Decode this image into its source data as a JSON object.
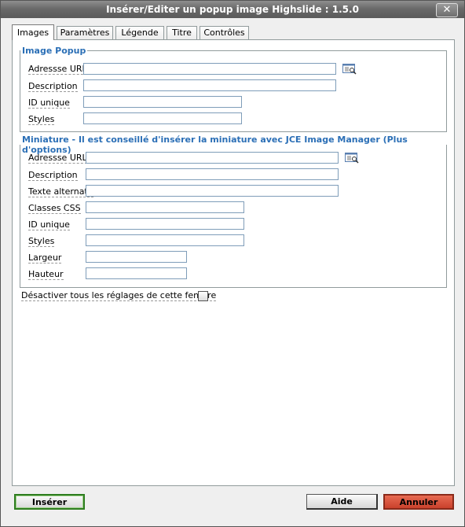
{
  "window": {
    "title": "Insérer/Editer un popup image Highslide : 1.5.0",
    "close_label": "✕"
  },
  "tabs": [
    {
      "label": "Images",
      "active": true
    },
    {
      "label": "Paramètres",
      "active": false
    },
    {
      "label": "Légende",
      "active": false
    },
    {
      "label": "Titre",
      "active": false
    },
    {
      "label": "Contrôles",
      "active": false
    }
  ],
  "popup_section": {
    "legend": "Image Popup",
    "fields": {
      "url": {
        "label": "Adressse URL",
        "value": ""
      },
      "description": {
        "label": "Description",
        "value": ""
      },
      "id": {
        "label": "ID unique",
        "value": ""
      },
      "styles": {
        "label": "Styles",
        "value": ""
      }
    }
  },
  "thumb_section": {
    "legend": "Miniature - Il est conseillé d'insérer la miniature avec JCE Image Manager (Plus d'options)",
    "fields": {
      "url": {
        "label": "Adressse URL",
        "value": ""
      },
      "description": {
        "label": "Description",
        "value": ""
      },
      "alt": {
        "label": "Texte alternatif",
        "value": ""
      },
      "classes": {
        "label": "Classes CSS",
        "value": ""
      },
      "id": {
        "label": "ID unique",
        "value": ""
      },
      "styles": {
        "label": "Styles",
        "value": ""
      },
      "width": {
        "label": "Largeur",
        "value": ""
      },
      "height": {
        "label": "Hauteur",
        "value": ""
      }
    }
  },
  "disable_settings": {
    "label": "Désactiver tous les réglages de cette fenêtre",
    "checked": false
  },
  "buttons": {
    "insert": "Insérer",
    "help": "Aide",
    "cancel": "Annuler"
  },
  "colors": {
    "legend": "#2b6fb6",
    "titlebar": "#6a6a6a",
    "insert_border": "#2e7d1f",
    "cancel_bg": "#c9412c"
  }
}
